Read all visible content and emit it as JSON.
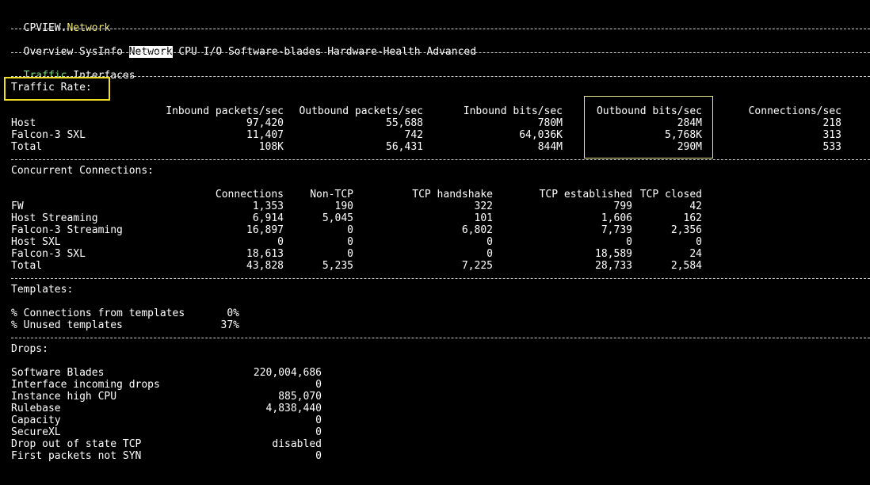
{
  "title": {
    "app": "CPVIEW.",
    "page": "Network"
  },
  "colors": {
    "accent_yellow": "#f0e86a",
    "accent_green": "#7cd87c",
    "highlight_box": "#f0e020"
  },
  "menu": {
    "items": [
      "Overview",
      "SysInfo",
      "Network",
      "CPU",
      "I/O",
      "Software-blades",
      "Hardware-Health",
      "Advanced"
    ],
    "selected": "Network"
  },
  "subtabs": {
    "items": [
      "Traffic",
      "Interfaces"
    ],
    "selected": "Traffic"
  },
  "traffic_rate": {
    "title": "Traffic Rate:",
    "headers": [
      "Inbound packets/sec",
      "Outbound packets/sec",
      "Inbound bits/sec",
      "Outbound bits/sec",
      "Connections/sec"
    ],
    "rows": [
      {
        "label": "Host",
        "values": [
          "97,420",
          "55,688",
          "780M",
          "284M",
          "218"
        ]
      },
      {
        "label": "Falcon-3 SXL",
        "values": [
          "11,407",
          "742",
          "64,036K",
          "5,768K",
          "313"
        ]
      },
      {
        "label": "Total",
        "values": [
          "108K",
          "56,431",
          "844M",
          "290M",
          "533"
        ]
      }
    ]
  },
  "concurrent": {
    "title": "Concurrent Connections:",
    "headers": [
      "Connections",
      "Non-TCP",
      "TCP handshake",
      "TCP established",
      "TCP closed"
    ],
    "rows": [
      {
        "label": "FW",
        "values": [
          "1,353",
          "190",
          "322",
          "799",
          "42"
        ]
      },
      {
        "label": "Host Streaming",
        "values": [
          "6,914",
          "5,045",
          "101",
          "1,606",
          "162"
        ]
      },
      {
        "label": "Falcon-3 Streaming",
        "values": [
          "16,897",
          "0",
          "6,802",
          "7,739",
          "2,356"
        ]
      },
      {
        "label": "Host SXL",
        "values": [
          "0",
          "0",
          "0",
          "0",
          "0"
        ]
      },
      {
        "label": "Falcon-3 SXL",
        "values": [
          "18,613",
          "0",
          "0",
          "18,589",
          "24"
        ]
      },
      {
        "label": "Total",
        "values": [
          "43,828",
          "5,235",
          "7,225",
          "28,733",
          "2,584"
        ]
      }
    ]
  },
  "templates": {
    "title": "Templates:",
    "rows": [
      {
        "label": "% Connections from templates",
        "value": "0%"
      },
      {
        "label": "% Unused templates",
        "value": "37%"
      }
    ]
  },
  "drops": {
    "title": "Drops:",
    "rows": [
      {
        "label": "Software Blades",
        "value": "220,004,686"
      },
      {
        "label": "Interface incoming drops",
        "value": "0"
      },
      {
        "label": "Instance high CPU",
        "value": "885,070"
      },
      {
        "label": "Rulebase",
        "value": "4,838,440"
      },
      {
        "label": "Capacity",
        "value": "0"
      },
      {
        "label": "SecureXL",
        "value": "0"
      },
      {
        "label": "Drop out of state TCP",
        "value": "disabled"
      },
      {
        "label": "First packets not SYN",
        "value": "0"
      }
    ]
  }
}
